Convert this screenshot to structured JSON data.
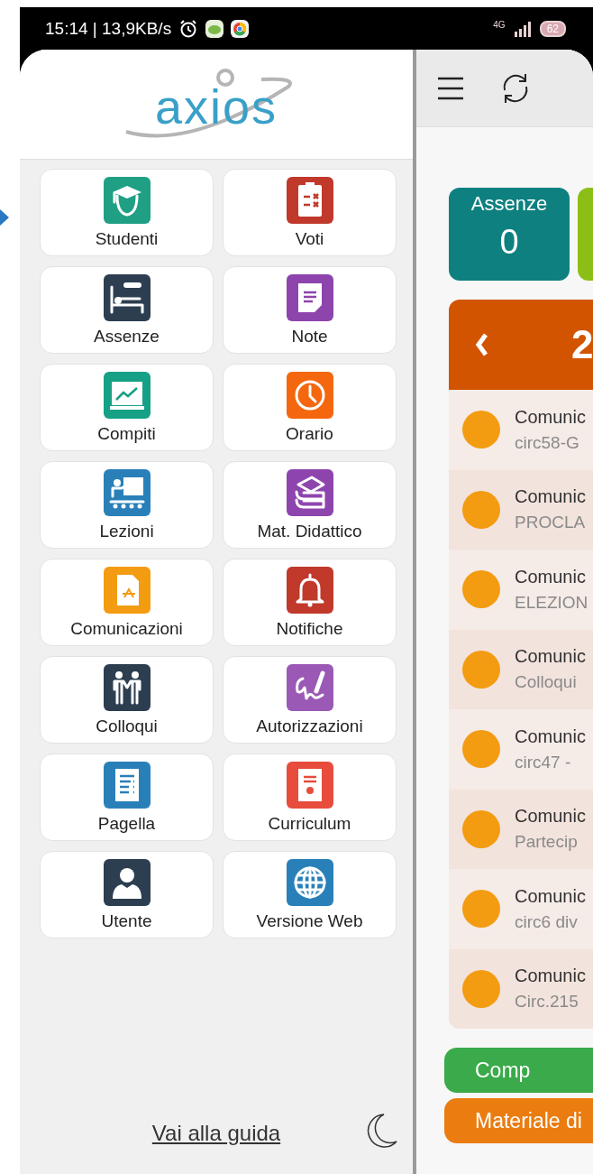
{
  "status_bar": {
    "time": "15:14 | 13,9KB/s",
    "network": "4G",
    "battery": "62"
  },
  "drawer": {
    "logo": "axios",
    "menu": [
      {
        "label": "Studenti",
        "color": "#1fa085"
      },
      {
        "label": "Voti",
        "color": "#c0392b"
      },
      {
        "label": "Assenze",
        "color": "#2c3e50"
      },
      {
        "label": "Note",
        "color": "#8e44ad"
      },
      {
        "label": "Compiti",
        "color": "#16a085"
      },
      {
        "label": "Orario",
        "color": "#f4670f"
      },
      {
        "label": "Lezioni",
        "color": "#2980b9"
      },
      {
        "label": "Mat. Didattico",
        "color": "#8e44ad"
      },
      {
        "label": "Comunicazioni",
        "color": "#f39c12"
      },
      {
        "label": "Notifiche",
        "color": "#c0392b"
      },
      {
        "label": "Colloqui",
        "color": "#2c3e50"
      },
      {
        "label": "Autorizzazioni",
        "color": "#9b59b6"
      },
      {
        "label": "Pagella",
        "color": "#2980b9"
      },
      {
        "label": "Curriculum",
        "color": "#e74c3c"
      },
      {
        "label": "Utente",
        "color": "#2c3e50"
      },
      {
        "label": "Versione Web",
        "color": "#2980b9"
      }
    ],
    "guide_link": "Vai alla guida"
  },
  "main": {
    "summary_tiles": [
      {
        "label": "Assenze",
        "value": "0",
        "color": "#0e8080"
      },
      {
        "color": "#8cbf16"
      }
    ],
    "period_header": {
      "value": "2"
    },
    "communications": [
      {
        "title": "Comunic",
        "subtitle": "circ58-G"
      },
      {
        "title": "Comunic",
        "subtitle": "PROCLA"
      },
      {
        "title": "Comunic",
        "subtitle": "ELEZION"
      },
      {
        "title": "Comunic",
        "subtitle": "Colloqui"
      },
      {
        "title": "Comunic",
        "subtitle": "circ47 -"
      },
      {
        "title": "Comunic",
        "subtitle": "Partecip"
      },
      {
        "title": "Comunic",
        "subtitle": "circ6 div"
      },
      {
        "title": "Comunic",
        "subtitle": "Circ.215"
      }
    ],
    "buttons": [
      {
        "label": "Comp",
        "color": "#3aaa4a"
      },
      {
        "label": "Materiale di",
        "color": "#ea7c10"
      }
    ]
  }
}
